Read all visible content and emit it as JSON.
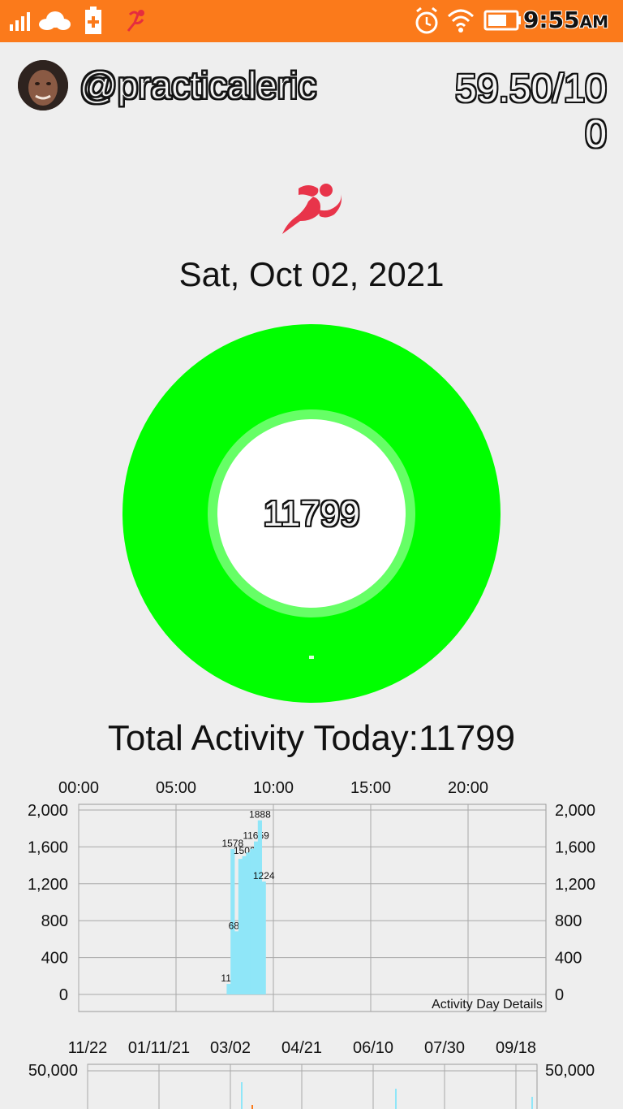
{
  "status_bar": {
    "time": "9:55",
    "ampm": "AM",
    "icons": [
      "signal-icon",
      "cloud-icon",
      "battery-saver-icon",
      "runner-notification-icon",
      "alarm-icon",
      "wifi-icon",
      "battery-icon"
    ]
  },
  "profile": {
    "username": "@practicaleric",
    "score": "59.50/100"
  },
  "date": "Sat, Oct 02, 2021",
  "ring": {
    "value": "11799",
    "ring_color": "#00ff00",
    "inner_ring_color": "#66ff66"
  },
  "total_label": "Total Activity Today:11799",
  "chart_data": [
    {
      "type": "bar",
      "x_top_ticks": [
        "00:00",
        "05:00",
        "10:00",
        "15:00",
        "20:00"
      ],
      "y_ticks": [
        "2,000",
        "1,600",
        "1,200",
        "800",
        "400",
        "0"
      ],
      "ylim": [
        0,
        2000
      ],
      "footer_label": "Activity Day Details",
      "bar_color": "#8fe6f8",
      "bars": [
        {
          "x": 7.6,
          "value": 114,
          "label": "114"
        },
        {
          "x": 7.8,
          "value": 1578,
          "label": "1578"
        },
        {
          "x": 8.0,
          "value": 684,
          "label": "684"
        },
        {
          "x": 8.2,
          "value": 1470,
          "label": ""
        },
        {
          "x": 8.4,
          "value": 1500,
          "label": "1506"
        },
        {
          "x": 8.6,
          "value": 1540,
          "label": ""
        },
        {
          "x": 8.8,
          "value": 1580,
          "label": ""
        },
        {
          "x": 9.0,
          "value": 1659,
          "label": "11659"
        },
        {
          "x": 9.2,
          "value": 1888,
          "label": "1888"
        },
        {
          "x": 9.4,
          "value": 1224,
          "label": "1224"
        }
      ]
    },
    {
      "type": "bar",
      "x_top_ticks": [
        "11/22",
        "01/11/21",
        "03/02",
        "04/21",
        "06/10",
        "07/30",
        "09/18"
      ],
      "y_ticks": [
        "50,000"
      ],
      "ylim": [
        0,
        50000
      ]
    }
  ]
}
